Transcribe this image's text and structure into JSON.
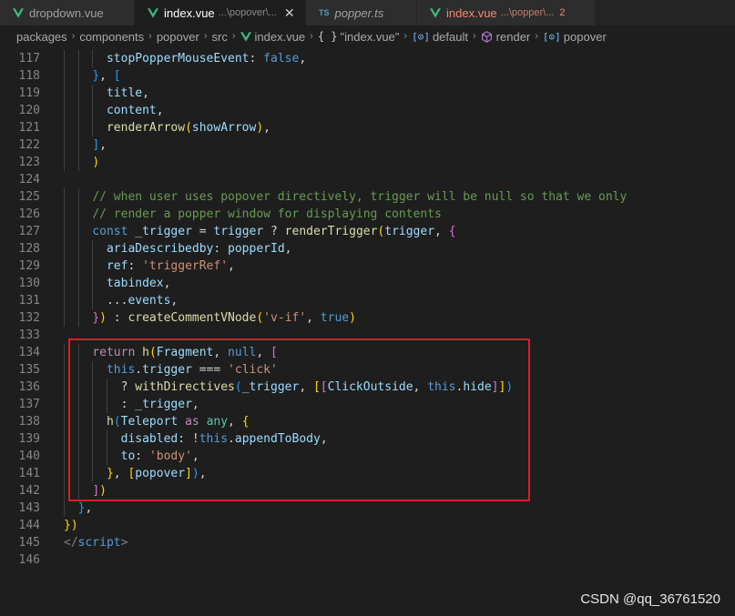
{
  "tabs": [
    {
      "label": "dropdown.vue",
      "icon": "vue-icon"
    },
    {
      "label": "index.vue",
      "description": "...\\popover\\...",
      "active": true,
      "icon": "vue-icon",
      "close": "✕"
    },
    {
      "label": "popper.ts",
      "icon": "ts-icon",
      "icon_text": "TS"
    },
    {
      "label": "index.vue",
      "description": "...\\popper\\...",
      "badge": "2",
      "icon": "vue-icon"
    }
  ],
  "breadcrumb": {
    "items": [
      "packages",
      "components",
      "popover",
      "src",
      "index.vue",
      "\"index.vue\"",
      "default",
      "render",
      "popover"
    ],
    "icons": {
      "braces": "{ }",
      "ref": "[⊙]"
    }
  },
  "editor": {
    "lines": [
      {
        "n": "117",
        "indent": 3,
        "tokens": [
          [
            "stopPopperMouseEvent",
            "prop"
          ],
          [
            ": ",
            "plain"
          ],
          [
            "false",
            "kw"
          ],
          [
            ",",
            "plain"
          ]
        ]
      },
      {
        "n": "118",
        "indent": 2,
        "tokens": [
          [
            "}",
            "b3"
          ],
          [
            ", ",
            "plain"
          ],
          [
            "[",
            "b3"
          ]
        ]
      },
      {
        "n": "119",
        "indent": 3,
        "tokens": [
          [
            "title",
            "prop"
          ],
          [
            ",",
            "plain"
          ]
        ]
      },
      {
        "n": "120",
        "indent": 3,
        "tokens": [
          [
            "content",
            "prop"
          ],
          [
            ",",
            "plain"
          ]
        ]
      },
      {
        "n": "121",
        "indent": 3,
        "tokens": [
          [
            "renderArrow",
            "fn"
          ],
          [
            "(",
            "b1"
          ],
          [
            "showArrow",
            "prop"
          ],
          [
            ")",
            "b1"
          ],
          [
            ",",
            "plain"
          ]
        ]
      },
      {
        "n": "122",
        "indent": 2,
        "tokens": [
          [
            "]",
            "b3"
          ],
          [
            ",",
            "plain"
          ]
        ]
      },
      {
        "n": "123",
        "indent": 2,
        "tokens": [
          [
            ")",
            "b1"
          ]
        ]
      },
      {
        "n": "124",
        "indent": 0,
        "tokens": []
      },
      {
        "n": "125",
        "indent": 2,
        "tokens": [
          [
            "// when user uses popover directively, trigger will be null so that we only",
            "com"
          ]
        ]
      },
      {
        "n": "126",
        "indent": 2,
        "tokens": [
          [
            "// render a popper window for displaying contents",
            "com"
          ]
        ]
      },
      {
        "n": "127",
        "indent": 2,
        "tokens": [
          [
            "const ",
            "kw"
          ],
          [
            "_trigger",
            "prop"
          ],
          [
            " = ",
            "plain"
          ],
          [
            "trigger",
            "prop"
          ],
          [
            " ? ",
            "plain"
          ],
          [
            "renderTrigger",
            "fn"
          ],
          [
            "(",
            "b1"
          ],
          [
            "trigger",
            "prop"
          ],
          [
            ", ",
            "plain"
          ],
          [
            "{",
            "b2"
          ]
        ]
      },
      {
        "n": "128",
        "indent": 3,
        "tokens": [
          [
            "ariaDescribedby",
            "prop"
          ],
          [
            ": ",
            "plain"
          ],
          [
            "popperId",
            "prop"
          ],
          [
            ",",
            "plain"
          ]
        ]
      },
      {
        "n": "129",
        "indent": 3,
        "tokens": [
          [
            "ref",
            "prop"
          ],
          [
            ": ",
            "plain"
          ],
          [
            "'triggerRef'",
            "str"
          ],
          [
            ",",
            "plain"
          ]
        ]
      },
      {
        "n": "130",
        "indent": 3,
        "tokens": [
          [
            "tabindex",
            "prop"
          ],
          [
            ",",
            "plain"
          ]
        ]
      },
      {
        "n": "131",
        "indent": 3,
        "tokens": [
          [
            "...",
            "plain"
          ],
          [
            "events",
            "prop"
          ],
          [
            ",",
            "plain"
          ]
        ]
      },
      {
        "n": "132",
        "indent": 2,
        "tokens": [
          [
            "}",
            "b2"
          ],
          [
            ")",
            "b1"
          ],
          [
            " : ",
            "plain"
          ],
          [
            "createCommentVNode",
            "fn"
          ],
          [
            "(",
            "b1"
          ],
          [
            "'v-if'",
            "str"
          ],
          [
            ", ",
            "plain"
          ],
          [
            "true",
            "kw"
          ],
          [
            ")",
            "b1"
          ]
        ]
      },
      {
        "n": "133",
        "indent": 0,
        "tokens": []
      },
      {
        "n": "134",
        "indent": 2,
        "tokens": [
          [
            "return ",
            "ctrl"
          ],
          [
            "h",
            "fn"
          ],
          [
            "(",
            "b1"
          ],
          [
            "Fragment",
            "prop"
          ],
          [
            ", ",
            "plain"
          ],
          [
            "null",
            "kw"
          ],
          [
            ", ",
            "plain"
          ],
          [
            "[",
            "b2"
          ]
        ]
      },
      {
        "n": "135",
        "indent": 3,
        "tokens": [
          [
            "this",
            "kw"
          ],
          [
            ".",
            "plain"
          ],
          [
            "trigger",
            "prop"
          ],
          [
            " === ",
            "plain"
          ],
          [
            "'click'",
            "str"
          ]
        ]
      },
      {
        "n": "136",
        "indent": 4,
        "tokens": [
          [
            "? ",
            "plain"
          ],
          [
            "withDirectives",
            "fn"
          ],
          [
            "(",
            "b3"
          ],
          [
            "_trigger",
            "prop"
          ],
          [
            ", ",
            "plain"
          ],
          [
            "[",
            "b1"
          ],
          [
            "[",
            "b2"
          ],
          [
            "ClickOutside",
            "prop"
          ],
          [
            ", ",
            "plain"
          ],
          [
            "this",
            "kw"
          ],
          [
            ".",
            "plain"
          ],
          [
            "hide",
            "prop"
          ],
          [
            "]",
            "b2"
          ],
          [
            "]",
            "b1"
          ],
          [
            ")",
            "b3"
          ]
        ]
      },
      {
        "n": "137",
        "indent": 4,
        "tokens": [
          [
            ": ",
            "plain"
          ],
          [
            "_trigger",
            "prop"
          ],
          [
            ",",
            "plain"
          ]
        ]
      },
      {
        "n": "138",
        "indent": 3,
        "tokens": [
          [
            "h",
            "fn"
          ],
          [
            "(",
            "b3"
          ],
          [
            "Teleport",
            "prop"
          ],
          [
            " as ",
            "ctrl"
          ],
          [
            "any",
            "type"
          ],
          [
            ", ",
            "plain"
          ],
          [
            "{",
            "b1"
          ]
        ]
      },
      {
        "n": "139",
        "indent": 4,
        "tokens": [
          [
            "disabled",
            "prop"
          ],
          [
            ": !",
            "plain"
          ],
          [
            "this",
            "kw"
          ],
          [
            ".",
            "plain"
          ],
          [
            "appendToBody",
            "prop"
          ],
          [
            ",",
            "plain"
          ]
        ]
      },
      {
        "n": "140",
        "indent": 4,
        "tokens": [
          [
            "to",
            "prop"
          ],
          [
            ": ",
            "plain"
          ],
          [
            "'body'",
            "str"
          ],
          [
            ",",
            "plain"
          ]
        ]
      },
      {
        "n": "141",
        "indent": 3,
        "tokens": [
          [
            "}",
            "b1"
          ],
          [
            ", ",
            "plain"
          ],
          [
            "[",
            "b1"
          ],
          [
            "popover",
            "prop"
          ],
          [
            "]",
            "b1"
          ],
          [
            ")",
            "b3"
          ],
          [
            ",",
            "plain"
          ]
        ]
      },
      {
        "n": "142",
        "indent": 2,
        "tokens": [
          [
            "]",
            "b2"
          ],
          [
            ")",
            "b1"
          ]
        ]
      },
      {
        "n": "143",
        "indent": 1,
        "tokens": [
          [
            "}",
            "b3"
          ],
          [
            ",",
            "plain"
          ]
        ]
      },
      {
        "n": "144",
        "indent": 0,
        "tokens": [
          [
            "}",
            "b1"
          ],
          [
            ")",
            "b1"
          ]
        ]
      },
      {
        "n": "145",
        "indent": 0,
        "tokens": [
          [
            "</",
            "tag"
          ],
          [
            "script",
            "tagname"
          ],
          [
            ">",
            "tag"
          ]
        ]
      },
      {
        "n": "146",
        "indent": 0,
        "tokens": []
      }
    ]
  },
  "watermark": "CSDN @qq_36761520",
  "colors": {
    "background": "#1e1e1e",
    "highlight_box": "#e01b24",
    "vue_icon": "#41b883",
    "ts_icon": "#519aba"
  }
}
